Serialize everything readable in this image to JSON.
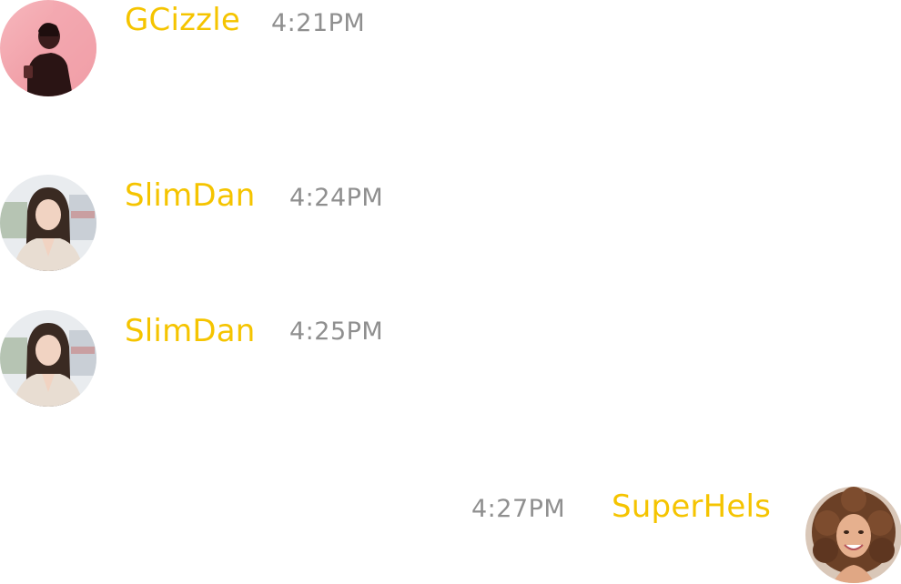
{
  "colors": {
    "username": "#f5c400",
    "timestamp": "#8f8f8f",
    "background": "#ffffff"
  },
  "messages": [
    {
      "username": "GCizzle",
      "time": "4:21PM",
      "avatar": "avatar-person-red-background",
      "align": "left"
    },
    {
      "username": "SlimDan",
      "time": "4:24PM",
      "avatar": "avatar-woman-street",
      "align": "left"
    },
    {
      "username": "SlimDan",
      "time": "4:25PM",
      "avatar": "avatar-woman-street",
      "align": "left"
    },
    {
      "username": "SuperHels",
      "time": "4:27PM",
      "avatar": "avatar-woman-curly-hair",
      "align": "right"
    }
  ]
}
